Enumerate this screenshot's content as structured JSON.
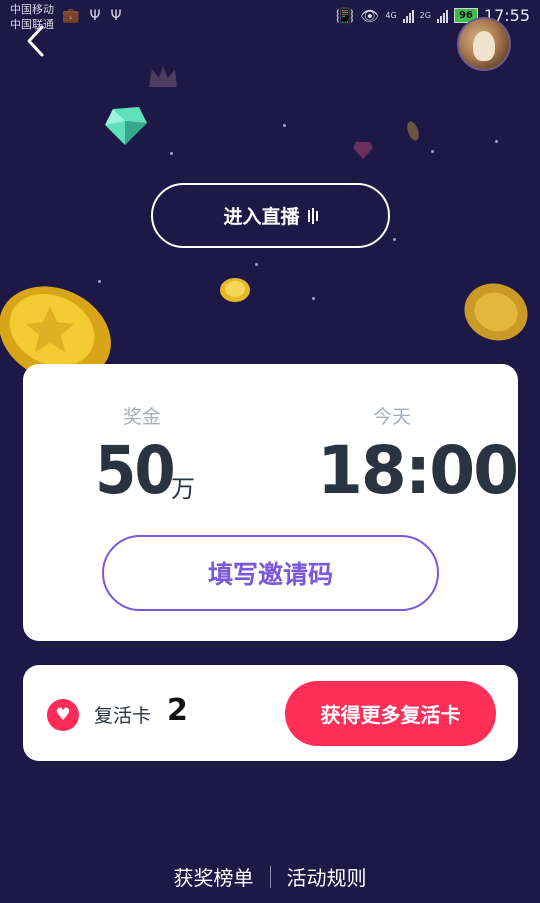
{
  "status_bar": {
    "carrier_1": "中国移动",
    "carrier_2": "中国联通",
    "network_1": "4G",
    "network_2": "2G",
    "battery": "96",
    "time": "17:55"
  },
  "header": {
    "back_icon": "chevron-left-icon",
    "avatar": "user-avatar"
  },
  "live_button": {
    "label": "进入直播"
  },
  "prize_card": {
    "prize_label": "奖金",
    "prize_value": "50",
    "prize_unit": "万",
    "time_label": "今天",
    "time_value": "18:00",
    "invite_button": "填写邀请码"
  },
  "revive_card": {
    "label": "复活卡",
    "count": "2",
    "get_more_button": "获得更多复活卡"
  },
  "footer": {
    "leaderboard": "获奖榜单",
    "rules": "活动规则"
  },
  "colors": {
    "background": "#1e1846",
    "accent_purple": "#7b57d9",
    "accent_red": "#ff2f58",
    "text_dark": "#2a3440",
    "text_muted": "#a6afc0"
  }
}
